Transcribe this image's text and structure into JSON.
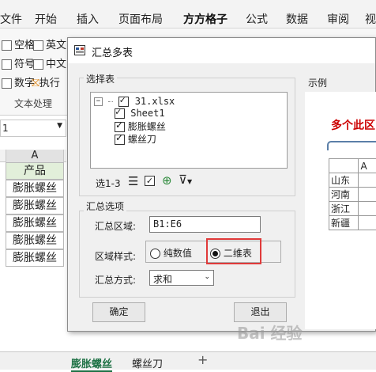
{
  "ribbon": {
    "tabs": [
      "文件",
      "开始",
      "插入",
      "页面布局",
      "方方格子",
      "公式",
      "数据",
      "审阅",
      "视"
    ],
    "active_tab": "方方格子",
    "items": {
      "kongge": "空格",
      "yingwen": "英文",
      "fuhao": "符号",
      "zhongwen": "中文",
      "shuzi": "数字",
      "zhixing": "执行"
    },
    "group_label": "文本处理"
  },
  "namebox": {
    "value": "1"
  },
  "sheet": {
    "column_a": "A",
    "cells": [
      "产品",
      "膨胀螺丝",
      "膨胀螺丝",
      "膨胀螺丝",
      "膨胀螺丝",
      "膨胀螺丝"
    ],
    "tabs": [
      "膨胀螺丝",
      "螺丝刀"
    ],
    "add_tab": "+"
  },
  "dialog": {
    "title": "汇总多表",
    "select_group": "选择表",
    "tree": {
      "root": "31.xlsx",
      "children": [
        "Sheet1",
        "膨胀螺丝",
        "螺丝刀"
      ]
    },
    "selection_count": "选1-3",
    "options_group": "汇总选项",
    "range_label": "汇总区域:",
    "range_value": "B1:E6",
    "style_label": "区域样式:",
    "style_options": [
      "纯数值",
      "二维表"
    ],
    "style_selected": "二维表",
    "method_label": "汇总方式:",
    "method_value": "求和",
    "ok_button": "确定",
    "exit_button": "退出",
    "example_group": "示例",
    "example_text": "多个此区",
    "example_header_col": "A",
    "example_rows": [
      "山东",
      "河南",
      "浙江",
      "新疆"
    ],
    "highlight_color": "#e03a3a",
    "example_title_color": "#cc0000"
  },
  "watermark": "Bai 经验"
}
